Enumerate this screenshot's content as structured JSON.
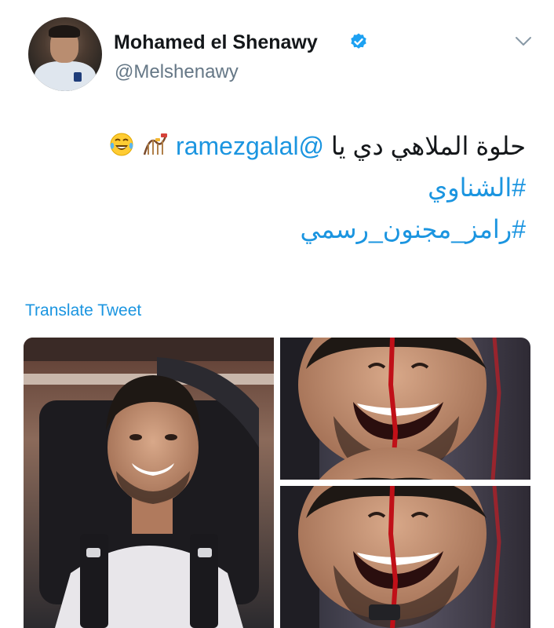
{
  "author": {
    "display_name": "Mohamed el Shenawy",
    "handle": "@Melshenawy",
    "verified": true,
    "avatar_icon": "profile-photo"
  },
  "tweet": {
    "text_part": "حلوة الملاهي دي يا",
    "mention": "@ramezgalal",
    "emojis": [
      "roller-coaster-icon",
      "tears-of-joy-icon"
    ],
    "hashtags": [
      "#الشناوي",
      "#رامز_مجنون_رسمي"
    ]
  },
  "actions": {
    "translate_label": "Translate Tweet",
    "menu_icon": "chevron-down-icon"
  },
  "media": {
    "count": 3,
    "images": [
      "photo-seated-smiling",
      "photo-laughing-top",
      "photo-laughing-bottom"
    ]
  },
  "colors": {
    "link": "#1b95e0",
    "secondary_text": "#657786",
    "verified": "#1da1f2"
  }
}
